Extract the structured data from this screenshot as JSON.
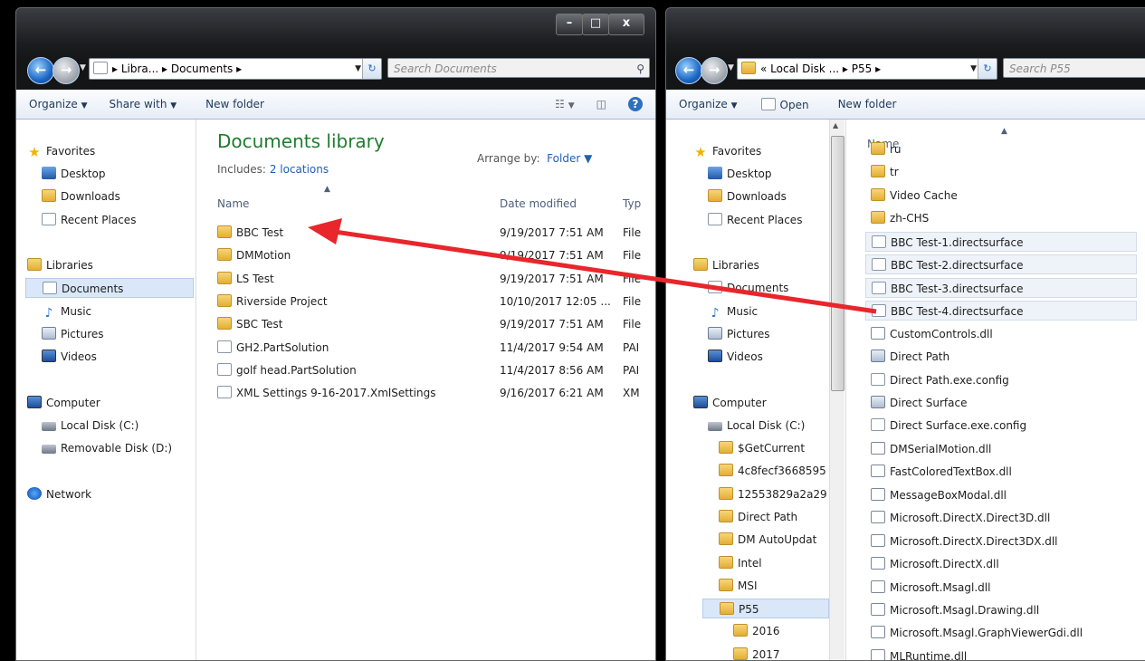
{
  "left_window": {
    "caption_buttons": {
      "minimize": "–",
      "maximize": "□",
      "close": "x"
    },
    "address": {
      "segments": "▸ Libra... ▸ Documents ▸"
    },
    "search_placeholder": "Search Documents",
    "toolbar": {
      "organize": "Organize",
      "share_with": "Share with",
      "new_folder": "New folder"
    },
    "nav": {
      "favorites": "Favorites",
      "desktop": "Desktop",
      "downloads": "Downloads",
      "recent_places": "Recent Places",
      "libraries": "Libraries",
      "documents": "Documents",
      "music": "Music",
      "pictures": "Pictures",
      "videos": "Videos",
      "computer": "Computer",
      "local_disk": "Local Disk (C:)",
      "removable_disk": "Removable Disk (D:)",
      "network": "Network"
    },
    "library": {
      "title": "Documents library",
      "includes_label": "Includes:",
      "includes_link": "2 locations",
      "arrange_label": "Arrange by:",
      "arrange_value": "Folder"
    },
    "columns": {
      "name": "Name",
      "date_modified": "Date modified",
      "type": "Typ"
    },
    "files": [
      {
        "name": "BBC Test",
        "date": "9/19/2017 7:51 AM",
        "type": "File",
        "icon": "folder-icon"
      },
      {
        "name": "DMMotion",
        "date": "9/19/2017 7:51 AM",
        "type": "File",
        "icon": "folder-icon"
      },
      {
        "name": "LS Test",
        "date": "9/19/2017 7:51 AM",
        "type": "File",
        "icon": "folder-icon"
      },
      {
        "name": "Riverside Project",
        "date": "10/10/2017 12:05 ...",
        "type": "File",
        "icon": "folder-icon"
      },
      {
        "name": "SBC Test",
        "date": "9/19/2017 7:51 AM",
        "type": "File",
        "icon": "folder-icon"
      },
      {
        "name": "GH2.PartSolution",
        "date": "11/4/2017 9:54 AM",
        "type": "PAI",
        "icon": "document-icon"
      },
      {
        "name": "golf head.PartSolution",
        "date": "11/4/2017 8:56 AM",
        "type": "PAI",
        "icon": "document-icon"
      },
      {
        "name": "XML Settings 9-16-2017.XmlSettings",
        "date": "9/16/2017 6:21 AM",
        "type": "XM",
        "icon": "document-icon"
      }
    ]
  },
  "right_window": {
    "address": {
      "segments": "« Local Disk ... ▸ P55 ▸"
    },
    "search_placeholder": "Search P55",
    "toolbar": {
      "organize": "Organize",
      "open": "Open",
      "new_folder": "New folder"
    },
    "nav": {
      "favorites": "Favorites",
      "desktop": "Desktop",
      "downloads": "Downloads",
      "recent_places": "Recent Places",
      "libraries": "Libraries",
      "documents": "Documents",
      "music": "Music",
      "pictures": "Pictures",
      "videos": "Videos",
      "computer": "Computer",
      "local_disk": "Local Disk (C:)",
      "folders": [
        "$GetCurrent",
        "4c8fecf3668595",
        "12553829a2a29",
        "Direct Path",
        "DM AutoUpdat",
        "Intel",
        "MSI",
        "P55"
      ],
      "subfolders": [
        "2016",
        "2017"
      ]
    },
    "columns": {
      "name": "Name"
    },
    "files": [
      {
        "name": "ru",
        "icon": "folder-icon"
      },
      {
        "name": "tr",
        "icon": "folder-icon"
      },
      {
        "name": "Video Cache",
        "icon": "folder-icon"
      },
      {
        "name": "zh-CHS",
        "icon": "folder-icon"
      },
      {
        "name": "BBC Test-1.directsurface",
        "icon": "document-icon"
      },
      {
        "name": "BBC Test-2.directsurface",
        "icon": "document-icon"
      },
      {
        "name": "BBC Test-3.directsurface",
        "icon": "document-icon"
      },
      {
        "name": "BBC Test-4.directsurface",
        "icon": "document-icon"
      },
      {
        "name": "CustomControls.dll",
        "icon": "dll-icon"
      },
      {
        "name": "Direct Path",
        "icon": "app-icon"
      },
      {
        "name": "Direct Path.exe.config",
        "icon": "document-icon"
      },
      {
        "name": "Direct Surface",
        "icon": "app-icon"
      },
      {
        "name": "Direct Surface.exe.config",
        "icon": "document-icon"
      },
      {
        "name": "DMSerialMotion.dll",
        "icon": "dll-icon"
      },
      {
        "name": "FastColoredTextBox.dll",
        "icon": "dll-icon"
      },
      {
        "name": "MessageBoxModal.dll",
        "icon": "dll-icon"
      },
      {
        "name": "Microsoft.DirectX.Direct3D.dll",
        "icon": "dll-icon"
      },
      {
        "name": "Microsoft.DirectX.Direct3DX.dll",
        "icon": "dll-icon"
      },
      {
        "name": "Microsoft.DirectX.dll",
        "icon": "dll-icon"
      },
      {
        "name": "Microsoft.Msagl.dll",
        "icon": "dll-icon"
      },
      {
        "name": "Microsoft.Msagl.Drawing.dll",
        "icon": "dll-icon"
      },
      {
        "name": "Microsoft.Msagl.GraphViewerGdi.dll",
        "icon": "dll-icon"
      },
      {
        "name": "MLRuntime.dll",
        "icon": "dll-icon"
      }
    ]
  },
  "annotation": {
    "color": "#e8262b"
  }
}
